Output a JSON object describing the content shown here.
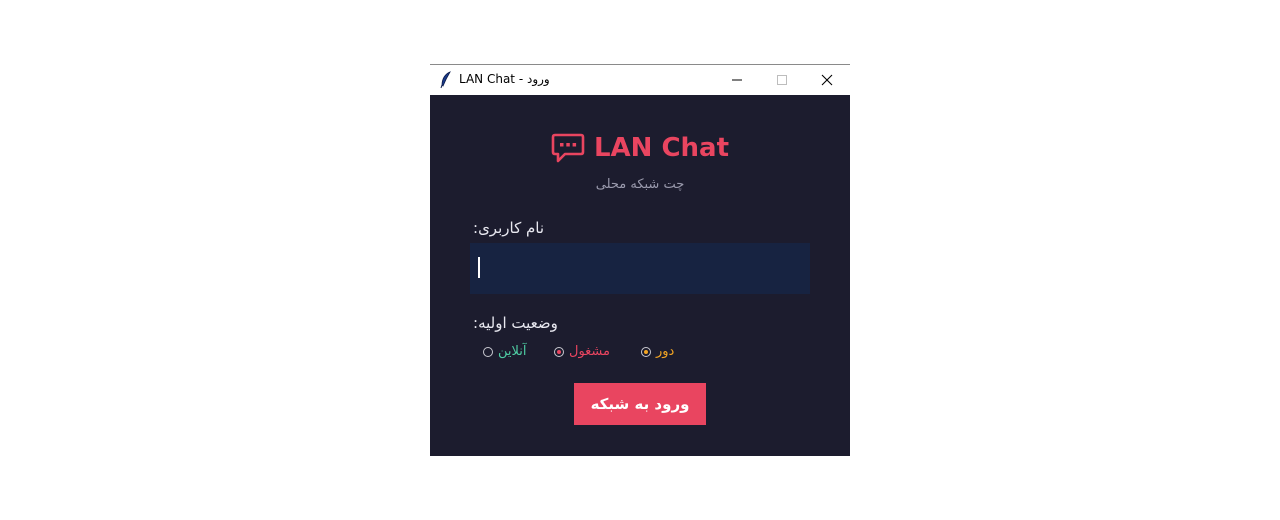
{
  "window": {
    "title": "LAN Chat - ورود"
  },
  "header": {
    "app_title": "LAN Chat",
    "subtitle": "چت شبکه محلی",
    "icon": "chat-bubble-icon",
    "accent_color": "#e94560"
  },
  "form": {
    "username_label": ":نام کاربری",
    "username_value": "",
    "status_label": ":وضعیت اولیه",
    "status_options": [
      {
        "label": "آنلاین",
        "color": "#4ecca3",
        "selected": false
      },
      {
        "label": "مشغول",
        "color": "#e94560",
        "selected": true
      },
      {
        "label": "دور",
        "color": "#f5a623",
        "selected": true
      }
    ],
    "submit_label": "ورود به شبکه"
  },
  "colors": {
    "background": "#1c1c2e",
    "input_background": "#172341"
  }
}
